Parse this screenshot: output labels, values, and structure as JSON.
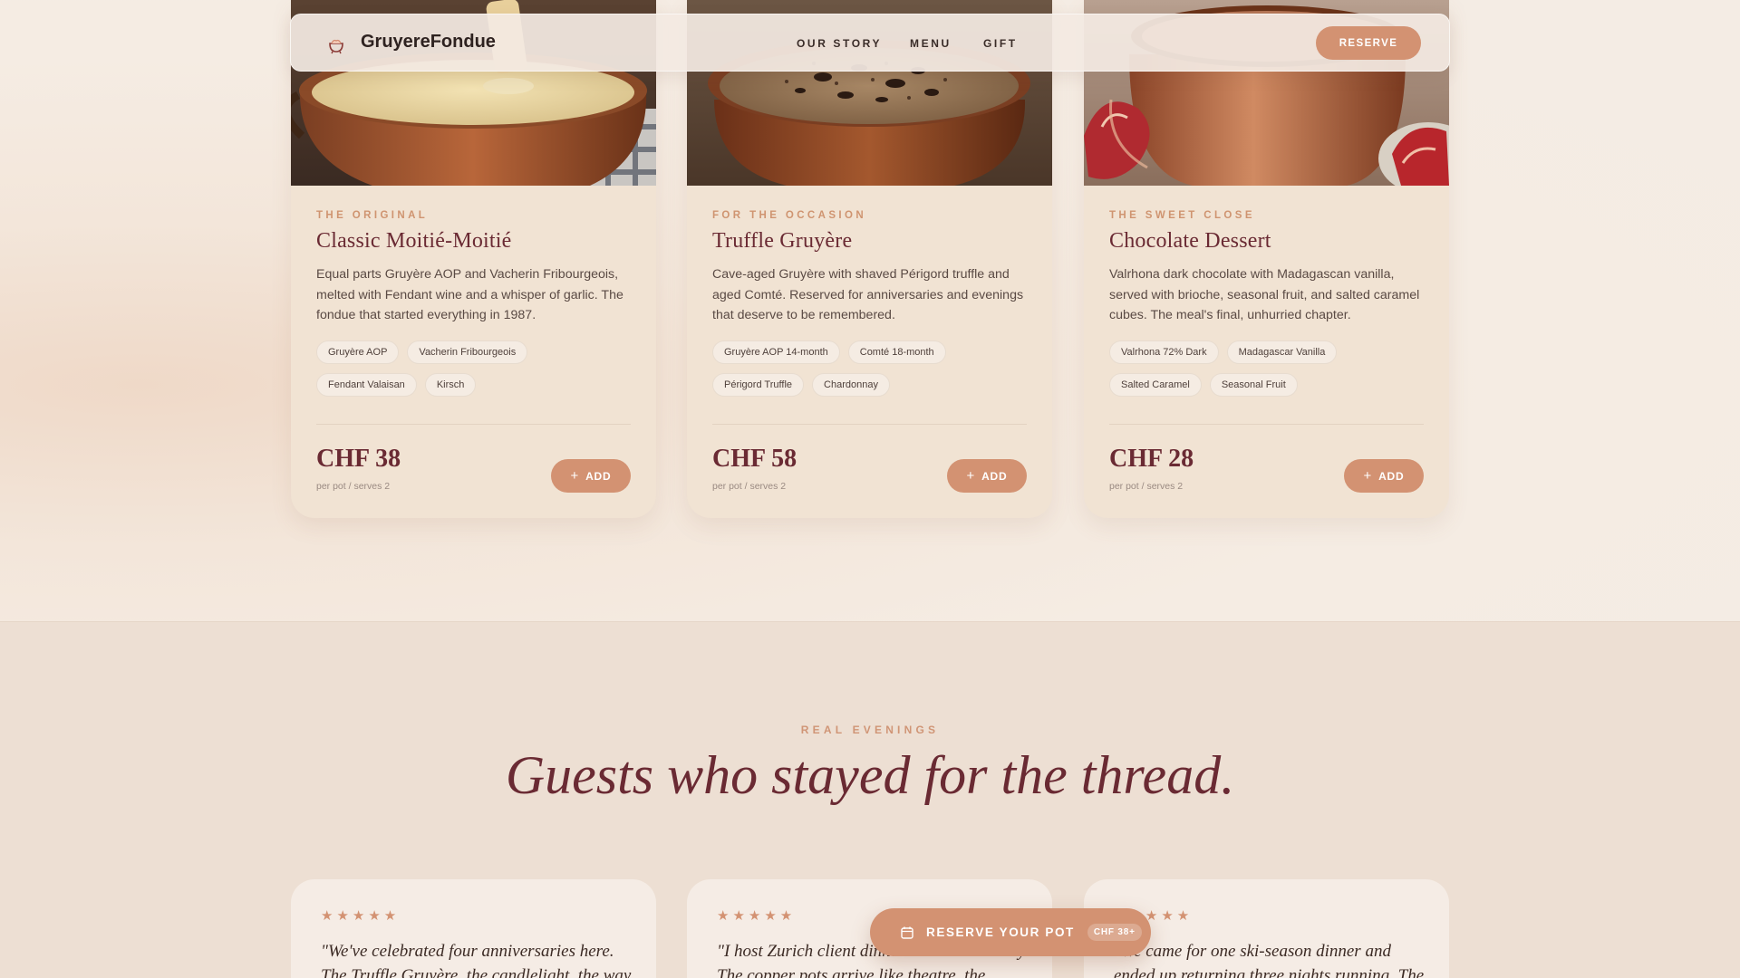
{
  "nav": {
    "brand": "GruyereFondue",
    "logo_icon": "fondue-pot-icon",
    "links": [
      "OUR STORY",
      "MENU",
      "GIFT"
    ],
    "reserve_label": "RESERVE"
  },
  "menu": {
    "cards": [
      {
        "eyebrow": "THE ORIGINAL",
        "title": "Classic Moitié-Moitié",
        "description": "Equal parts Gruyère AOP and Vacherin Fribourgeois, melted with Fendant wine and a whisper of garlic. The fondue that started everything in 1987.",
        "tags": [
          "Gruyère AOP",
          "Vacherin Fribourgeois",
          "Fendant Valaisan",
          "Kirsch"
        ],
        "price": "CHF 38",
        "per": "per pot / serves 2",
        "add_label": "ADD"
      },
      {
        "eyebrow": "FOR THE OCCASION",
        "title": "Truffle Gruyère",
        "description": "Cave-aged Gruyère with shaved Périgord truffle and aged Comté. Reserved for anniversaries and evenings that deserve to be remembered.",
        "tags": [
          "Gruyère AOP 14-month",
          "Comté 18-month",
          "Périgord Truffle",
          "Chardonnay"
        ],
        "price": "CHF 58",
        "per": "per pot / serves 2",
        "add_label": "ADD"
      },
      {
        "eyebrow": "THE SWEET CLOSE",
        "title": "Chocolate Dessert",
        "description": "Valrhona dark chocolate with Madagascan vanilla, served with brioche, seasonal fruit, and salted caramel cubes. The meal's final, unhurried chapter.",
        "tags": [
          "Valrhona 72% Dark",
          "Madagascar Vanilla",
          "Salted Caramel",
          "Seasonal Fruit"
        ],
        "price": "CHF 28",
        "per": "per pot / serves 2",
        "add_label": "ADD"
      }
    ]
  },
  "testimonials": {
    "eyebrow": "REAL EVENINGS",
    "title": "Guests who stayed for the thread.",
    "items": [
      {
        "rating": 5,
        "stars": "★★★★★",
        "quote": "\"We've celebrated four anniversaries here. The Truffle Gruyère, the candlelight, the way the"
      },
      {
        "rating": 5,
        "stars": "★★★★★",
        "quote": "\"I host Zurich client dinners here exclusively. The copper pots arrive like theatre, the cheese"
      },
      {
        "rating": 5,
        "stars": "★★★★★",
        "quote": "\"We came for one ski-season dinner and ended up returning three nights running. The Moitié"
      }
    ]
  },
  "cta": {
    "icon": "calendar-icon",
    "label": "RESERVE YOUR POT",
    "badge": "CHF 38+"
  },
  "colors": {
    "accent": "#d39272",
    "title": "#6a2a33",
    "card_bg": "#f1e3d3",
    "page_bg": "#f4ebe2"
  }
}
